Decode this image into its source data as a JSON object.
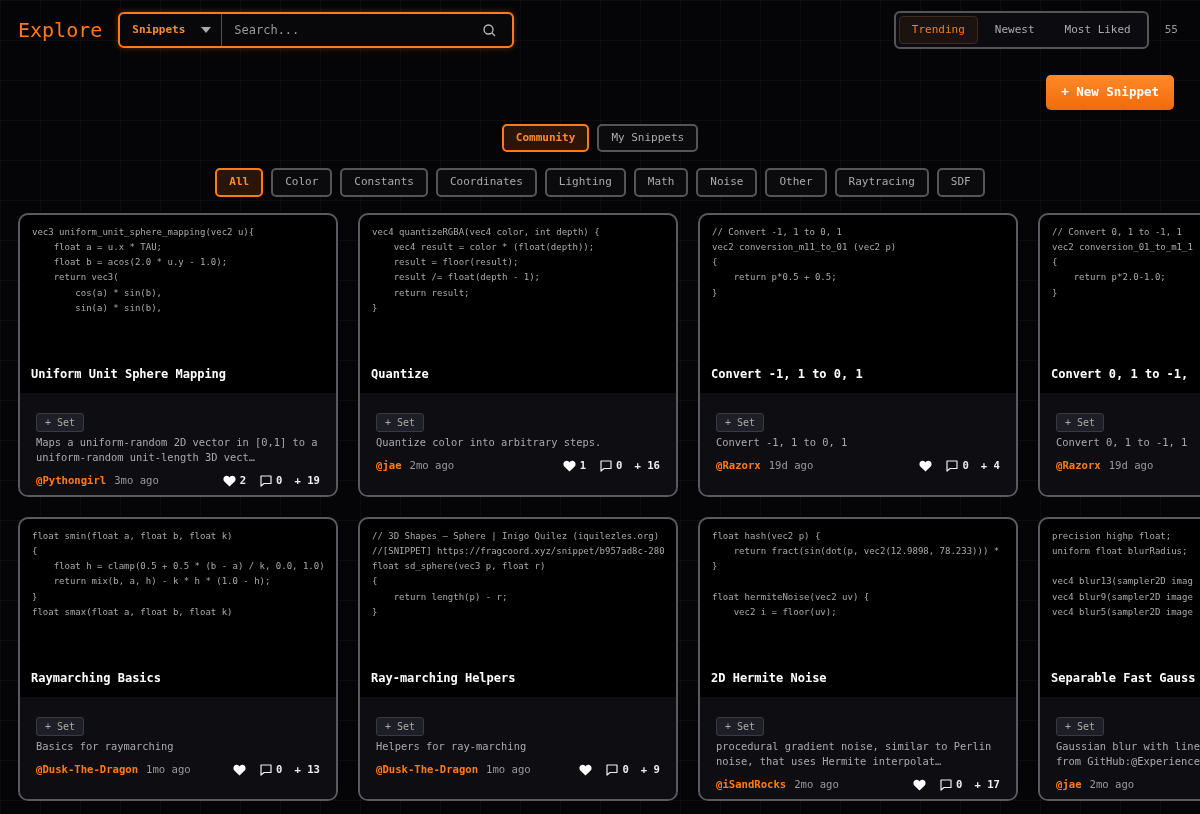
{
  "header": {
    "title": "Explore",
    "search": {
      "scope": "Snippets",
      "placeholder": "Search..."
    },
    "sort_tabs": [
      {
        "label": "Trending",
        "selected": true
      },
      {
        "label": "Newest",
        "selected": false
      },
      {
        "label": "Most Liked",
        "selected": false
      }
    ],
    "count": "55",
    "new_button": "+ New Snippet"
  },
  "source_tabs": [
    {
      "label": "Community",
      "selected": true
    },
    {
      "label": "My Snippets",
      "selected": false
    }
  ],
  "categories": [
    {
      "label": "All",
      "selected": true
    },
    {
      "label": "Color",
      "selected": false
    },
    {
      "label": "Constants",
      "selected": false
    },
    {
      "label": "Coordinates",
      "selected": false
    },
    {
      "label": "Lighting",
      "selected": false
    },
    {
      "label": "Math",
      "selected": false
    },
    {
      "label": "Noise",
      "selected": false
    },
    {
      "label": "Other",
      "selected": false
    },
    {
      "label": "Raytracing",
      "selected": false
    },
    {
      "label": "SDF",
      "selected": false
    }
  ],
  "cards": [
    {
      "code": [
        "vec3 uniform_unit_sphere_mapping(vec2 u){",
        "    float a = u.x * TAU;",
        "    float b = acos(2.0 * u.y - 1.0);",
        "    return vec3(",
        "        cos(a) * sin(b),",
        "        sin(a) * sin(b),"
      ],
      "title": "Uniform Unit Sphere Mapping",
      "set_button": "+ Set",
      "description": "Maps a uniform-random 2D vector in [0,1] to a uniform-random unit-length 3D vect…",
      "author": "@Pythongirl",
      "time": "3mo ago",
      "likes": "2",
      "comments": "0",
      "adds": "+ 19"
    },
    {
      "code": [
        "vec4 quantizeRGBA(vec4 color, int depth) {",
        "    vec4 result = color * (float(depth));",
        "    result = floor(result);",
        "    result /= float(depth - 1);",
        "    return result;",
        "}"
      ],
      "title": "Quantize",
      "set_button": "+ Set",
      "description": "Quantize color into arbitrary steps.",
      "author": "@jae",
      "time": "2mo ago",
      "likes": "1",
      "comments": "0",
      "adds": "+ 16"
    },
    {
      "code": [
        "// Convert -1, 1 to 0, 1",
        "vec2 conversion_m11_to_01 (vec2 p)",
        "{",
        "    return p*0.5 + 0.5;",
        "}"
      ],
      "title": "Convert -1, 1 to 0, 1",
      "set_button": "+ Set",
      "description": "Convert -1, 1 to 0, 1",
      "author": "@Razorx",
      "time": "19d ago",
      "comments": "0",
      "adds": "+ 4"
    },
    {
      "code": [
        "// Convert 0, 1 to -1, 1",
        "vec2 conversion_01_to_m1_1",
        "{",
        "    return p*2.0-1.0;",
        "}"
      ],
      "title": "Convert 0, 1 to -1,",
      "set_button": "+ Set",
      "description": "Convert 0, 1 to -1, 1",
      "author": "@Razorx",
      "time": "19d ago",
      "cut": true
    },
    {
      "code": [
        "float smin(float a, float b, float k)",
        "{",
        "    float h = clamp(0.5 + 0.5 * (b - a) / k, 0.0, 1.0)",
        "    return mix(b, a, h) - k * h * (1.0 - h);",
        "}",
        "float smax(float a, float b, float k)"
      ],
      "title": "Raymarching Basics",
      "set_button": "+ Set",
      "description": "Basics for raymarching",
      "author": "@Dusk-The-Dragon",
      "time": "1mo ago",
      "comments": "0",
      "adds": "+ 13"
    },
    {
      "code": [
        "// 3D Shapes — Sphere | Inigo Quilez (iquilezles.org)",
        "//[SNIPPET] https://fragcoord.xyz/snippet/b957ad8c-280",
        "float sd_sphere(vec3 p, float r)",
        "{",
        "    return length(p) - r;",
        "}"
      ],
      "title": "Ray-marching Helpers",
      "set_button": "+ Set",
      "description": "Helpers for ray-marching",
      "author": "@Dusk-The-Dragon",
      "time": "1mo ago",
      "comments": "0",
      "adds": "+ 9"
    },
    {
      "code": [
        [
          "float hash(vec2 p) {",
          "    return fract(sin(dot(p, vec2(12.9898, 78.233))) *",
          "}"
        ],
        [
          "float hermiteNoise(vec2 uv) {",
          "    vec2 i = floor(uv);"
        ]
      ],
      "title": "2D Hermite Noise",
      "set_button": "+ Set",
      "description": "procedural gradient noise, similar to Perlin noise, that uses Hermite interpolat…",
      "author": "@iSandRocks",
      "time": "2mo ago",
      "comments": "0",
      "adds": "+ 17"
    },
    {
      "code": [
        [
          "precision highp float;",
          "uniform float blurRadius;"
        ],
        [
          "vec4 blur13(sampler2D imag",
          "vec4 blur9(sampler2D image",
          "vec4 blur5(sampler2D image"
        ]
      ],
      "title": "Separable Fast Gauss",
      "set_button": "+ Set",
      "description": "Gaussian blur with line from GitHub:@Experience",
      "author": "@jae",
      "time": "2mo ago",
      "cut": true
    }
  ]
}
